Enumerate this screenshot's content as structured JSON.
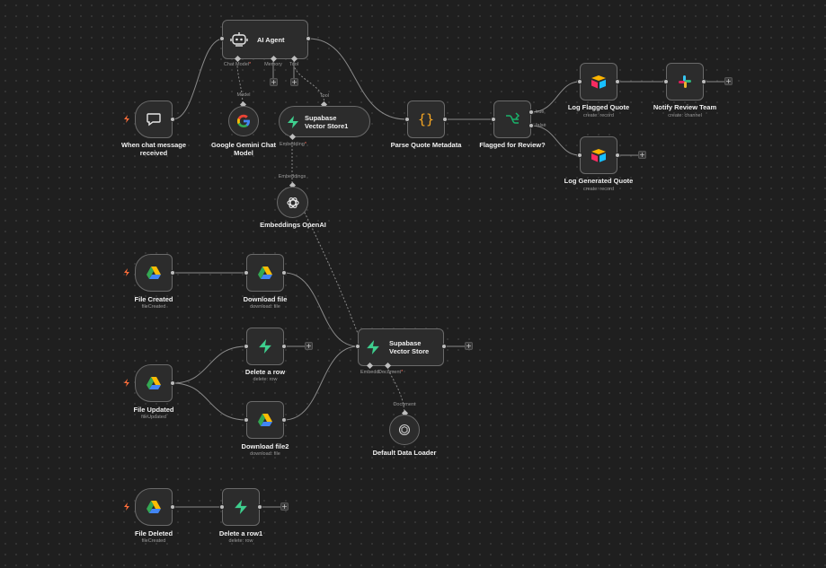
{
  "colors": {
    "canvas_bg": "#1f1f1f",
    "node_bg": "#2c2c2c",
    "node_border": "#6a6a6a",
    "wire": "#8a8a8a",
    "trigger_bolt": "#ff6d3a",
    "required": "#ff6f5c",
    "supabase_green": "#3ecf8e",
    "code_orange": "#f5a623",
    "if_green": "#19b36b"
  },
  "nodes": {
    "chat_trigger": {
      "label": "When chat message received",
      "icon": "chat-bubble-icon"
    },
    "ai_agent": {
      "label": "AI Agent",
      "icon": "robot-icon",
      "ports": {
        "chat_model": "Chat Model",
        "memory": "Memory",
        "tool": "Tool",
        "required_mark": "*"
      }
    },
    "gemini": {
      "label": "Google Gemini Chat Model",
      "icon": "google-icon",
      "port": "Model"
    },
    "vector_store_tool": {
      "label": "Supabase Vector Store1",
      "icon": "supabase-icon",
      "port_top": "Tool",
      "port_bottom": "Embedding",
      "required_mark": "*"
    },
    "embeddings_openai": {
      "label": "Embeddings OpenAI",
      "icon": "openai-icon",
      "port": "Embeddings"
    },
    "parse_quote": {
      "label": "Parse Quote Metadata",
      "icon": "code-braces-icon"
    },
    "flagged_if": {
      "label": "Flagged for Review?",
      "icon": "if-branch-icon",
      "out_true": "true",
      "out_false": "false"
    },
    "log_flagged": {
      "label": "Log Flagged Quote",
      "sub": "create: record",
      "icon": "airtable-icon"
    },
    "notify_team": {
      "label": "Notify Review Team",
      "sub": "create: channel",
      "icon": "slack-icon"
    },
    "log_generated": {
      "label": "Log Generated Quote",
      "sub": "create: record",
      "icon": "airtable-icon"
    },
    "file_created": {
      "label": "File Created",
      "sub": "fileCreated",
      "icon": "google-drive-icon"
    },
    "download_file": {
      "label": "Download file",
      "sub": "download: file",
      "icon": "google-drive-icon"
    },
    "file_updated": {
      "label": "File Updated",
      "sub": "fileUpdated",
      "icon": "google-drive-icon"
    },
    "delete_row": {
      "label": "Delete a row",
      "sub": "delete: row",
      "icon": "supabase-icon"
    },
    "download_file2": {
      "label": "Download file2",
      "sub": "download: file",
      "icon": "google-drive-icon"
    },
    "vector_store": {
      "label": "Supabase Vector Store",
      "icon": "supabase-icon",
      "port_embedding": "Embeddi",
      "port_document": "Document",
      "required_mark": "*"
    },
    "data_loader": {
      "label": "Default Data Loader",
      "icon": "document-loader-icon",
      "port": "Document"
    },
    "file_deleted": {
      "label": "File Deleted",
      "sub": "fileCreated",
      "icon": "google-drive-icon"
    },
    "delete_row1": {
      "label": "Delete a row1",
      "sub": "delete: row",
      "icon": "supabase-icon"
    }
  }
}
